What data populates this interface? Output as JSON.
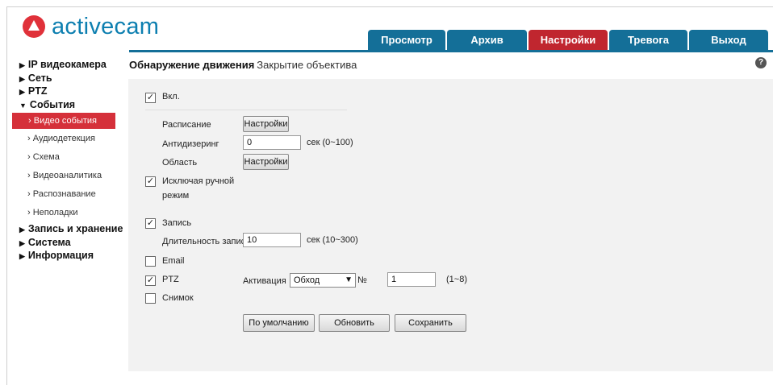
{
  "brand": {
    "name": "activecam",
    "accent": "#0d7fb0",
    "logo_color": "#e0313a"
  },
  "top_tabs": [
    {
      "label": "Просмотр"
    },
    {
      "label": "Архив"
    },
    {
      "label": "Настройки"
    },
    {
      "label": "Тревога"
    },
    {
      "label": "Выход"
    }
  ],
  "sidebar": {
    "items": [
      {
        "label": "IP видеокамера"
      },
      {
        "label": "Сеть"
      },
      {
        "label": "PTZ"
      },
      {
        "label": "События"
      }
    ],
    "sub_items": [
      {
        "label": "Видео события"
      },
      {
        "label": "Аудиодетекция"
      },
      {
        "label": "Схема"
      },
      {
        "label": "Видеоаналитика"
      },
      {
        "label": "Распознавание"
      },
      {
        "label": "Неполадки"
      }
    ],
    "items_after": [
      {
        "label": "Запись и хранение"
      },
      {
        "label": "Система"
      },
      {
        "label": "Информация"
      }
    ]
  },
  "subtabs": {
    "active": "Обнаружение движения",
    "other": "Закрытие объектива"
  },
  "help": {
    "icon": "question-icon",
    "symbol": "?"
  },
  "form": {
    "enable_label": "Вкл.",
    "schedule_label": "Расписание",
    "schedule_button": "Настройки",
    "antidither_label": "Антидизеринг",
    "antidither_value": "0",
    "antidither_hint": "сек (0~100)",
    "area_label": "Область",
    "area_button": "Настройки",
    "manual_line1": "Исключая ручной",
    "manual_line2": "режим",
    "record_label": "Запись",
    "record_duration_label": "Длительность записи",
    "record_duration_value": "10",
    "record_duration_hint": "сек (10~300)",
    "email_label": "Email",
    "ptz_label": "PTZ",
    "activation_label": "Активация",
    "activation_value": "Обход",
    "number_label": "№",
    "number_value": "1",
    "number_hint": "(1~8)",
    "snapshot_label": "Снимок",
    "checks": {
      "enable": true,
      "manual": true,
      "record": true,
      "email": false,
      "ptz": true,
      "snapshot": false
    },
    "default_button": "По умолчанию",
    "refresh_button": "Обновить",
    "save_button": "Сохранить"
  }
}
